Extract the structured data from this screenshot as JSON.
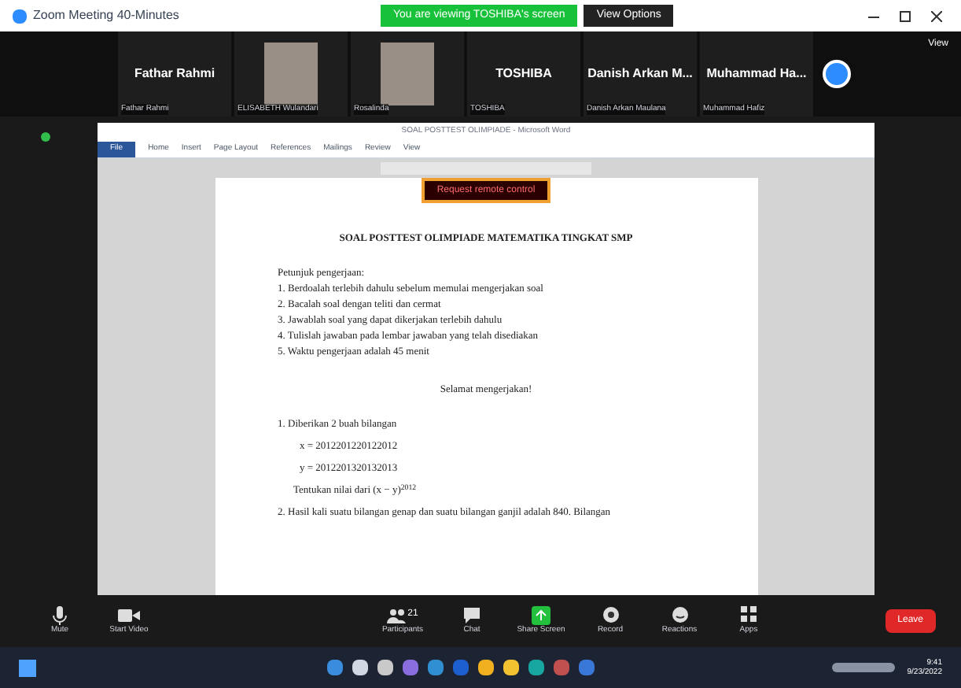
{
  "window": {
    "title": "Zoom Meeting 40-Minutes"
  },
  "share_banner": {
    "text": "You are viewing TOSHIBA's screen",
    "button": "View Options"
  },
  "participants": [
    {
      "kind": "name",
      "display": "Fathar Rahmi",
      "label": "Fathar Rahmi"
    },
    {
      "kind": "photo",
      "label": "ELISABETH Wulandari"
    },
    {
      "kind": "photo",
      "label": "Rosalinda"
    },
    {
      "kind": "name",
      "display": "TOSHIBA",
      "label": "TOSHIBA"
    },
    {
      "kind": "name",
      "display": "Danish Arkan M...",
      "label": "Danish Arkan Maulana"
    },
    {
      "kind": "name",
      "display": "Muhammad Ha...",
      "label": "Muhammad Hafiz"
    }
  ],
  "view_button": "View",
  "document": {
    "title": "SOAL POSTTEST OLIMPIADE - Microsoft Word",
    "ribbon_tabs": [
      {
        "label": "File",
        "selected": true
      },
      {
        "label": "Home",
        "selected": false
      },
      {
        "label": "Insert",
        "selected": false
      },
      {
        "label": "Page Layout",
        "selected": false
      },
      {
        "label": "References",
        "selected": false
      },
      {
        "label": "Mailings",
        "selected": false
      },
      {
        "label": "Review",
        "selected": false
      },
      {
        "label": "View",
        "selected": false
      }
    ],
    "remote_control": "Request remote control",
    "heading": "SOAL POSTTEST OLIMPIADE MATEMATIKA TINGKAT SMP",
    "intro": "Petunjuk pengerjaan:",
    "instructions": [
      "1. Berdoalah terlebih dahulu sebelum memulai mengerjakan soal",
      "2. Bacalah soal dengan teliti dan cermat",
      "3. Jawablah soal yang dapat dikerjakan terlebih dahulu",
      "4. Tulislah jawaban pada lembar jawaban yang telah disediakan",
      "5. Waktu pengerjaan adalah 45 menit"
    ],
    "greeting": "Selamat mengerjakan!",
    "q1": "1. Diberikan 2 buah bilangan",
    "q1_lines": [
      "x = 2012201220122012",
      "y = 2012201320132013"
    ],
    "q1_ask": "Tentukan nilai dari (x − y)$^{2012}$",
    "q2": "2. Hasil kali suatu bilangan genap dan suatu bilangan ganjil adalah 840. Bilangan"
  },
  "controls": [
    {
      "kind": "mic",
      "label": "Mute"
    },
    {
      "kind": "video",
      "label": "Start Video"
    },
    {
      "kind": "people",
      "label": "Participants",
      "count": "21"
    },
    {
      "kind": "chat",
      "label": "Chat"
    },
    {
      "kind": "share",
      "label": "Share Screen"
    },
    {
      "kind": "record",
      "label": "Record"
    },
    {
      "kind": "react",
      "label": "Reactions"
    },
    {
      "kind": "apps",
      "label": "Apps"
    }
  ],
  "leave": "Leave",
  "clock": {
    "time": "9:41",
    "date": "9/23/2022"
  }
}
